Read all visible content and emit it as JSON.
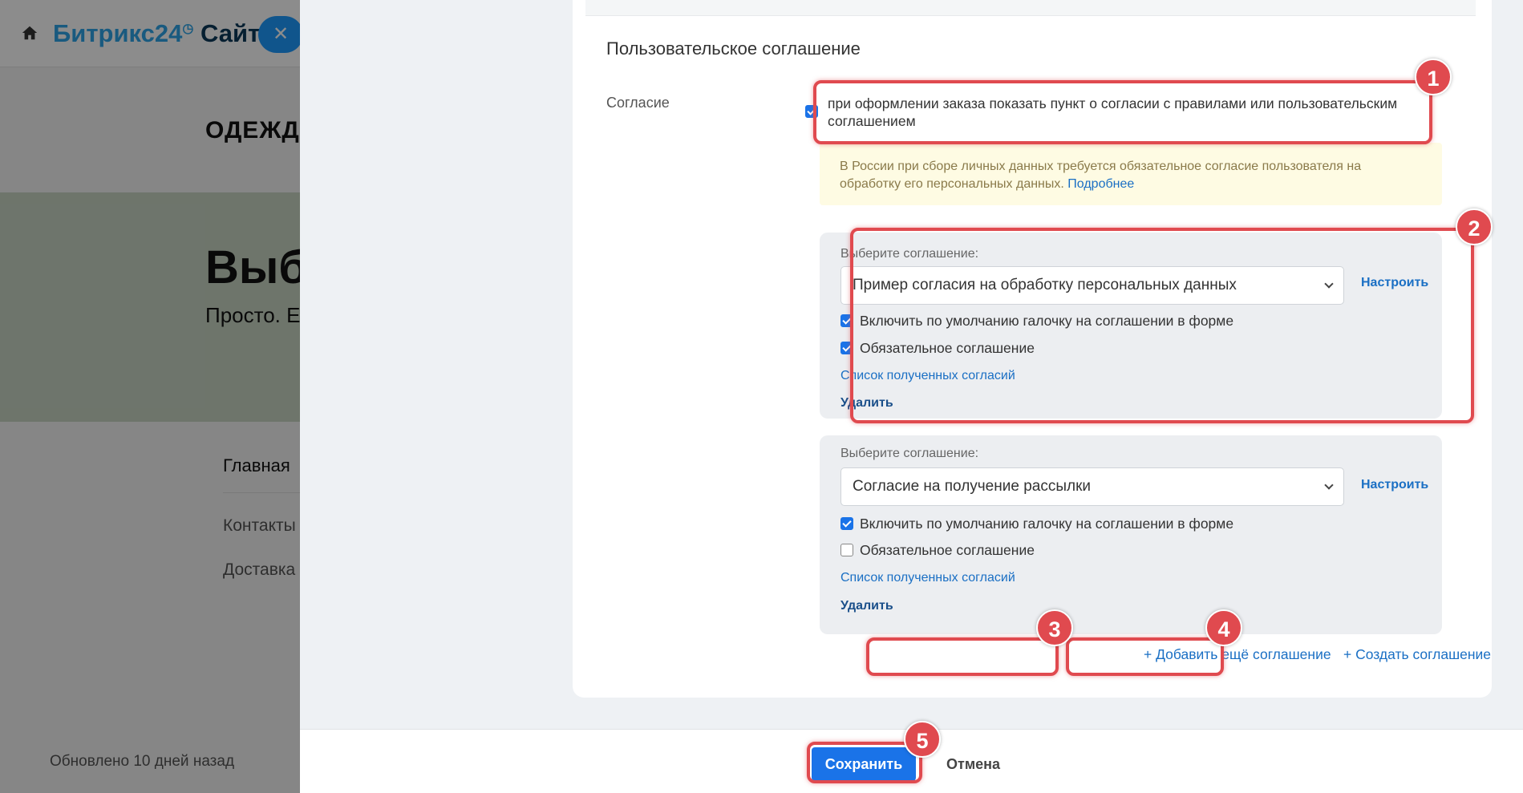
{
  "colors": {
    "accent": "#1a73e8",
    "highlight": "#e04a4f",
    "link": "#1a6fc4",
    "notice_bg": "#fefbe3"
  },
  "background_page": {
    "logo_bitrix": "Битрикс24",
    "logo_sites": "Сайты",
    "close_icon": "✕",
    "brand": "ОДЕЖД",
    "hero_title": "Выб",
    "hero_subtitle": "Просто. Е",
    "nav": [
      "Главная",
      "Контакты",
      "Доставка"
    ],
    "updated": "Обновлено 10 дней назад"
  },
  "section": {
    "title": "Пользовательское соглашение",
    "field_label": "Согласие",
    "consent_checkbox_checked": true,
    "consent_text": "при оформлении заказа показать пункт о согласии с правилами или пользовательским соглашением",
    "notice_text": "В России при сборе личных данных требуется обязательное согласие пользователя на обработку его персональных данных.",
    "notice_link": "Подробнее"
  },
  "agreements": [
    {
      "select_label": "Выберите соглашение:",
      "selected": "Пример согласия на обработку персональных данных",
      "configure": "Настроить",
      "default_check_label": "Включить по умолчанию галочку на соглашении в форме",
      "default_check": true,
      "required_label": "Обязательное соглашение",
      "required": true,
      "list_link": "Список полученных согласий",
      "delete": "Удалить"
    },
    {
      "select_label": "Выберите соглашение:",
      "selected": "Согласие на получение рассылки",
      "configure": "Настроить",
      "default_check_label": "Включить по умолчанию галочку на соглашении в форме",
      "default_check": true,
      "required_label": "Обязательное соглашение",
      "required": false,
      "list_link": "Список полученных согласий",
      "delete": "Удалить"
    }
  ],
  "actions": {
    "add_agreement": "+ Добавить ещё соглашение",
    "create_agreement": "+ Создать соглашение"
  },
  "footer": {
    "save": "Сохранить",
    "cancel": "Отмена"
  },
  "badges": [
    "1",
    "2",
    "3",
    "4",
    "5"
  ]
}
